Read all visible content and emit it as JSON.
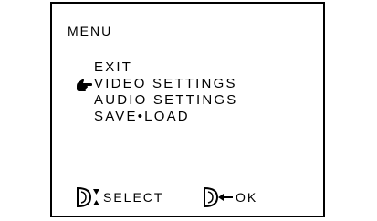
{
  "menu": {
    "title": "MENU",
    "items": [
      {
        "label": "EXIT",
        "selected": false
      },
      {
        "label": "VIDEO SETTINGS",
        "selected": true
      },
      {
        "label": "AUDIO SETTINGS",
        "selected": false
      },
      {
        "label": "SAVE•LOAD",
        "selected": false
      }
    ],
    "cursor_icon": "pointing-hand-icon"
  },
  "footer": {
    "select": {
      "label": "SELECT",
      "icon": "dial-up-down-icon"
    },
    "ok": {
      "label": "OK",
      "icon": "dial-press-icon"
    }
  }
}
